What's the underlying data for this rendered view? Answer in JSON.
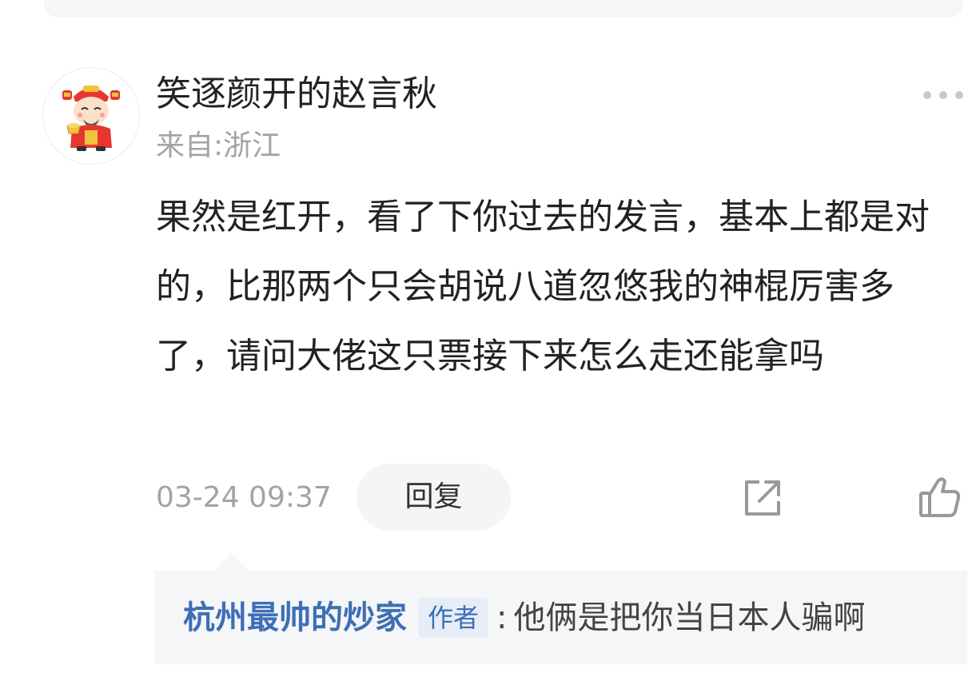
{
  "comment": {
    "username": "笑逐颜开的赵言秋",
    "location": "来自:浙江",
    "text": "果然是红开，看了下你过去的发言，基本上都是对的，比那两个只会胡说八道忽悠我的神棍厉害多了，请问大佬这只票接下来怎么走还能拿吗",
    "timestamp": "03-24 09:37",
    "reply_label": "回复",
    "avatar_icon": "god-of-wealth-avatar-icon",
    "more_icon": "more-dots-icon",
    "share_icon": "share-icon",
    "like_icon": "thumbs-up-icon"
  },
  "reply": {
    "author": "杭州最帅的炒家",
    "badge": "作者",
    "separator": ":",
    "text": "他俩是把你当日本人骗啊"
  },
  "colors": {
    "author_link": "#3d6fb6",
    "secondary_text": "#a3a3a3",
    "reply_bg": "#f5f6f7"
  }
}
